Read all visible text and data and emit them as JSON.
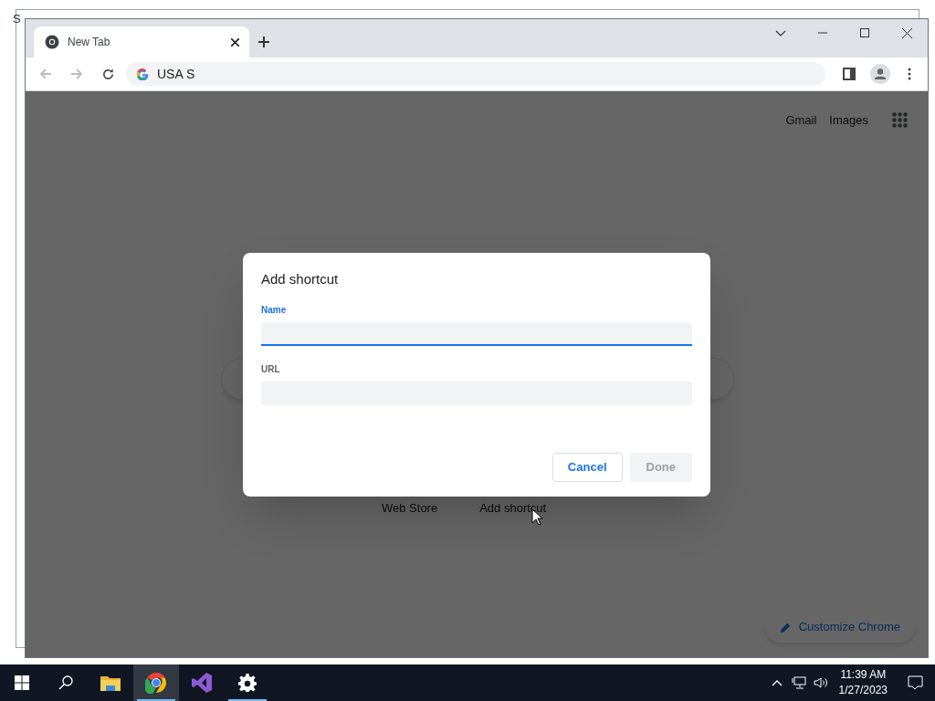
{
  "background_window": {
    "title_fragment": "S"
  },
  "browser": {
    "tabs": [
      {
        "title": "New Tab",
        "selected": true
      }
    ],
    "omnibox": {
      "value": "USA S"
    },
    "page": {
      "top_links": [
        "Gmail",
        "Images"
      ],
      "shortcuts": [
        {
          "label": "Web Store"
        },
        {
          "label": "Add shortcut"
        }
      ],
      "customize_button": "Customize Chrome"
    }
  },
  "dialog": {
    "title": "Add shortcut",
    "fields": [
      {
        "label": "Name",
        "focused": true
      },
      {
        "label": "URL",
        "focused": false
      }
    ],
    "buttons": [
      {
        "label": "Cancel",
        "disabled": false
      },
      {
        "label": "Done",
        "disabled": true
      }
    ]
  },
  "taskbar": {
    "apps": [
      {
        "kind": "explorer",
        "selected": false,
        "running": false
      },
      {
        "kind": "chrome",
        "selected": true,
        "running": true
      },
      {
        "kind": "studio",
        "selected": false,
        "running": false
      },
      {
        "kind": "settings",
        "selected": false,
        "running": true
      }
    ],
    "clock": {
      "time": "11:39 AM",
      "date": "1/27/2023"
    }
  }
}
